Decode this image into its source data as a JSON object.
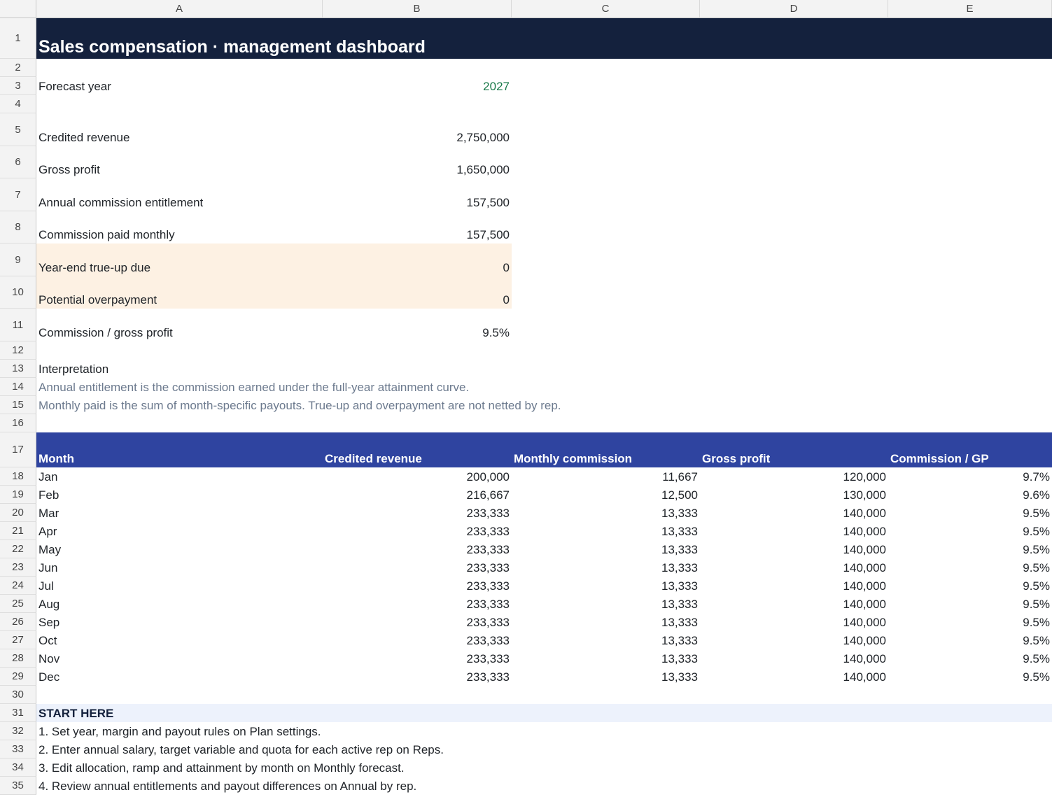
{
  "columns": [
    "A",
    "B",
    "C",
    "D",
    "E"
  ],
  "rows": [
    "1",
    "2",
    "3",
    "4",
    "5",
    "6",
    "7",
    "8",
    "9",
    "10",
    "11",
    "12",
    "13",
    "14",
    "15",
    "16",
    "17",
    "18",
    "19",
    "20",
    "21",
    "22",
    "23",
    "24",
    "25",
    "26",
    "27",
    "28",
    "29",
    "30",
    "31",
    "32",
    "33",
    "34",
    "35"
  ],
  "colors": {
    "title_bg": "#14213d",
    "table_header_bg": "#2f44a0",
    "highlight_bg": "#fdf1e3",
    "start_bg": "#edf2fc",
    "input_text": "#1a7a4a",
    "note_text": "#6c7a8e"
  },
  "title": "Sales compensation · management dashboard",
  "forecast": {
    "label": "Forecast year",
    "value": "2027"
  },
  "kpis": [
    {
      "label": "Credited revenue",
      "value": "2,750,000"
    },
    {
      "label": "Gross profit",
      "value": "1,650,000"
    },
    {
      "label": "Annual commission entitlement",
      "value": "157,500"
    },
    {
      "label": "Commission paid monthly",
      "value": "157,500"
    },
    {
      "label": "Year-end true-up due",
      "value": "0"
    },
    {
      "label": "Potential overpayment",
      "value": "0"
    },
    {
      "label": "Commission / gross profit",
      "value": "9.5%"
    }
  ],
  "interpretation": {
    "heading": "Interpretation",
    "lines": [
      "Annual entitlement is the commission earned under the full-year attainment curve.",
      "Monthly paid is the sum of month-specific payouts. True-up and overpayment are not netted by rep."
    ]
  },
  "table": {
    "headers": [
      "Month",
      "Credited revenue",
      "Monthly commission",
      "Gross profit",
      "Commission / GP"
    ],
    "rows": [
      [
        "Jan",
        "200,000",
        "11,667",
        "120,000",
        "9.7%"
      ],
      [
        "Feb",
        "216,667",
        "12,500",
        "130,000",
        "9.6%"
      ],
      [
        "Mar",
        "233,333",
        "13,333",
        "140,000",
        "9.5%"
      ],
      [
        "Apr",
        "233,333",
        "13,333",
        "140,000",
        "9.5%"
      ],
      [
        "May",
        "233,333",
        "13,333",
        "140,000",
        "9.5%"
      ],
      [
        "Jun",
        "233,333",
        "13,333",
        "140,000",
        "9.5%"
      ],
      [
        "Jul",
        "233,333",
        "13,333",
        "140,000",
        "9.5%"
      ],
      [
        "Aug",
        "233,333",
        "13,333",
        "140,000",
        "9.5%"
      ],
      [
        "Sep",
        "233,333",
        "13,333",
        "140,000",
        "9.5%"
      ],
      [
        "Oct",
        "233,333",
        "13,333",
        "140,000",
        "9.5%"
      ],
      [
        "Nov",
        "233,333",
        "13,333",
        "140,000",
        "9.5%"
      ],
      [
        "Dec",
        "233,333",
        "13,333",
        "140,000",
        "9.5%"
      ]
    ]
  },
  "start": {
    "heading": "START HERE",
    "steps": [
      "1. Set year, margin and payout rules on Plan settings.",
      "2. Enter annual salary, target variable and quota for each active rep on Reps.",
      "3. Edit allocation, ramp and attainment by month on Monthly forecast.",
      "4. Review annual entitlements and payout differences on Annual by rep."
    ]
  }
}
